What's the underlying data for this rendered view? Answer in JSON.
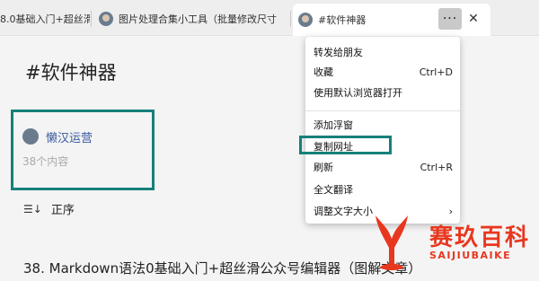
{
  "tabs": [
    {
      "title": "8.0基础入门+超丝滑"
    },
    {
      "title": "图片处理合集小工具（批量修改尺寸"
    },
    {
      "title": "#软件神器",
      "active": true
    }
  ],
  "tab_controls": {
    "more_icon": "more-horizontal-icon",
    "more_glyph": "···",
    "close_glyph": "✕"
  },
  "page": {
    "title": "#软件神器",
    "author": {
      "name": "懒汉运营",
      "count": "38个内容"
    },
    "sort": {
      "icon": "sort-icon",
      "glyph": "☰↓",
      "label": "正序"
    },
    "article_title": "38. Markdown语法0基础入门+超丝滑公众号编辑器（图解文章）"
  },
  "context_menu": {
    "items": [
      {
        "label": "转发给朋友",
        "shortcut": ""
      },
      {
        "label": "收藏",
        "shortcut": "Ctrl+D"
      },
      {
        "label": "使用默认浏览器打开",
        "shortcut": ""
      },
      {
        "label": "添加浮窗",
        "shortcut": ""
      },
      {
        "label": "复制网址",
        "shortcut": "",
        "highlighted": true
      },
      {
        "label": "刷新",
        "shortcut": "Ctrl+R"
      },
      {
        "label": "全文翻译",
        "shortcut": ""
      },
      {
        "label": "调整文字大小",
        "shortcut": "",
        "submenu": true
      }
    ]
  },
  "watermark": {
    "text_cn": "赛玖百科",
    "text_en": "SAIJIUBAIKE"
  },
  "colors": {
    "highlight": "#16807a",
    "link": "#3a5ba0",
    "watermark": "#e8371f"
  }
}
